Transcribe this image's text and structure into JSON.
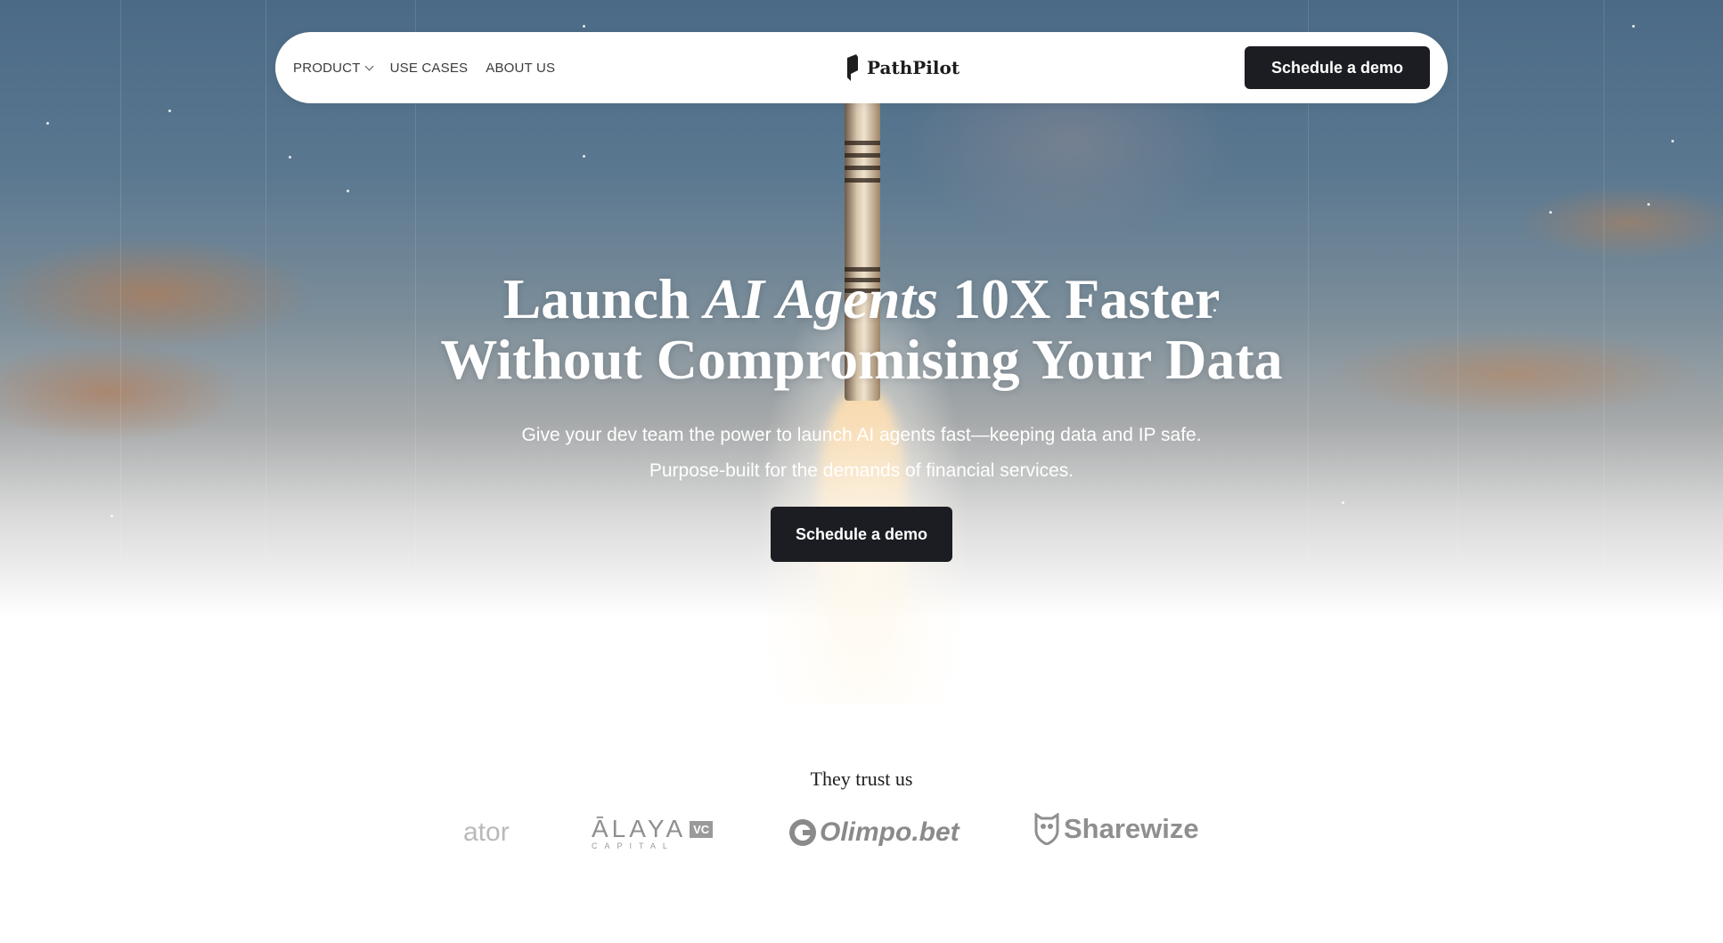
{
  "nav": {
    "items": [
      {
        "label": "PRODUCT",
        "has_dropdown": true
      },
      {
        "label": "USE CASES",
        "has_dropdown": false
      },
      {
        "label": "ABOUT US",
        "has_dropdown": false
      }
    ],
    "brand": "PathPilot",
    "cta_label": "Schedule a demo"
  },
  "hero": {
    "headline_launch": "Launch",
    "headline_emphasis": "AI Agents",
    "headline_rest": "10X Faster",
    "headline_line2": "Without Compromising Your Data",
    "subtext_line1": "Give your dev team the power to launch AI agents fast—keeping data and IP safe.",
    "subtext_line2": "Purpose-built for the demands of financial services.",
    "cta_label": "Schedule a demo"
  },
  "trust": {
    "title": "They trust us",
    "logos": {
      "partial": "ator",
      "alaya_name": "ĀLAYA",
      "alaya_badge": "VC",
      "alaya_sub": "CAPITAL",
      "olimpo": "Olimpo.bet",
      "sharewize": "Sharewize"
    }
  },
  "colors": {
    "button_bg": "#1b1d22",
    "logo_gray": "#8a8a8a"
  }
}
